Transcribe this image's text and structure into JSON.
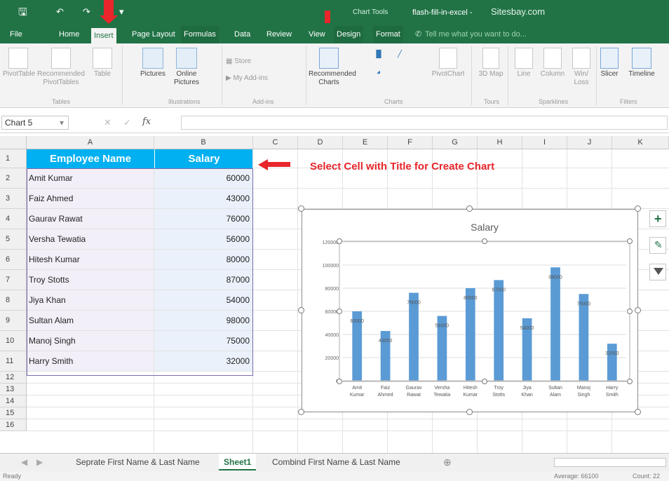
{
  "titlebar": {
    "context_label": "Chart Tools",
    "filename": "flash-fill-in-excel -",
    "site": "Sitesbay.com"
  },
  "tabs": [
    "File",
    "Home",
    "Insert",
    "Page Layout",
    "Formulas",
    "Data",
    "Review",
    "View",
    "Design",
    "Format"
  ],
  "tell_me": "Tell me what you want to do...",
  "ribbon": {
    "pivottable": "PivotTable",
    "rec_pivot": "Recommended PivotTables",
    "table": "Table",
    "pictures": "Pictures",
    "online_pictures": "Online Pictures",
    "store": "Store",
    "my_addins": "My Add-ins",
    "rec_charts": "Recommended Charts",
    "pivotchart": "PivotChart",
    "map3d": "3D Map",
    "line": "Line",
    "column": "Column",
    "winloss": "Win/ Loss",
    "slicer": "Slicer",
    "timeline": "Timeline",
    "groups": [
      "Tables",
      "Illustrations",
      "Add-ins",
      "Charts",
      "Tours",
      "Sparklines",
      "Filters"
    ]
  },
  "namebox": "Chart 5",
  "fx": "fx",
  "columns": [
    "A",
    "B",
    "C",
    "D",
    "E",
    "F",
    "G",
    "H",
    "I",
    "J",
    "K"
  ],
  "header": {
    "name": "Employee Name",
    "salary": "Salary"
  },
  "rows": [
    {
      "name": "Amit Kumar",
      "salary": "60000"
    },
    {
      "name": "Faiz Ahmed",
      "salary": "43000"
    },
    {
      "name": "Gaurav Rawat",
      "salary": "76000"
    },
    {
      "name": "Versha Tewatia",
      "salary": "56000"
    },
    {
      "name": "Hitesh Kumar",
      "salary": "80000"
    },
    {
      "name": "Troy Stotts",
      "salary": "87000"
    },
    {
      "name": "Jiya Khan",
      "salary": "54000"
    },
    {
      "name": "Sultan Alam",
      "salary": "98000"
    },
    {
      "name": "Manoj Singh",
      "salary": "75000"
    },
    {
      "name": "Harry Smith",
      "salary": "32000"
    }
  ],
  "row_numbers": [
    "1",
    "2",
    "3",
    "4",
    "5",
    "6",
    "7",
    "8",
    "9",
    "10",
    "11",
    "12",
    "13",
    "14",
    "15",
    "16"
  ],
  "annotation": "Select Cell with Title for Create Chart",
  "sheets": [
    "Seprate First Name & Last Name",
    "Sheet1",
    "Combind First Name & Last Name"
  ],
  "status": {
    "ready": "Ready",
    "average": "Average: 66100",
    "count": "Count: 22"
  },
  "colors": {
    "excel_green": "#217346",
    "header_blue": "#00b0f0",
    "bar": "#5b9bd5",
    "arrow": "#e8262b"
  },
  "chart_data": {
    "type": "bar",
    "title": "Salary",
    "categories": [
      "Amit Kumar",
      "Faiz Ahmed",
      "Gaurav Rawat",
      "Versha Tewatia",
      "Hitesh Kumar",
      "Troy Stotts",
      "Jiya Khan",
      "Sultan Alam",
      "Manoj Singh",
      "Harry Smith"
    ],
    "values": [
      60000,
      43000,
      76000,
      56000,
      80000,
      87000,
      54000,
      98000,
      75000,
      32000
    ],
    "ylim": [
      0,
      120000
    ],
    "yticks": [
      0,
      20000,
      40000,
      60000,
      80000,
      100000,
      120000
    ],
    "grid": true,
    "data_labels": true
  }
}
